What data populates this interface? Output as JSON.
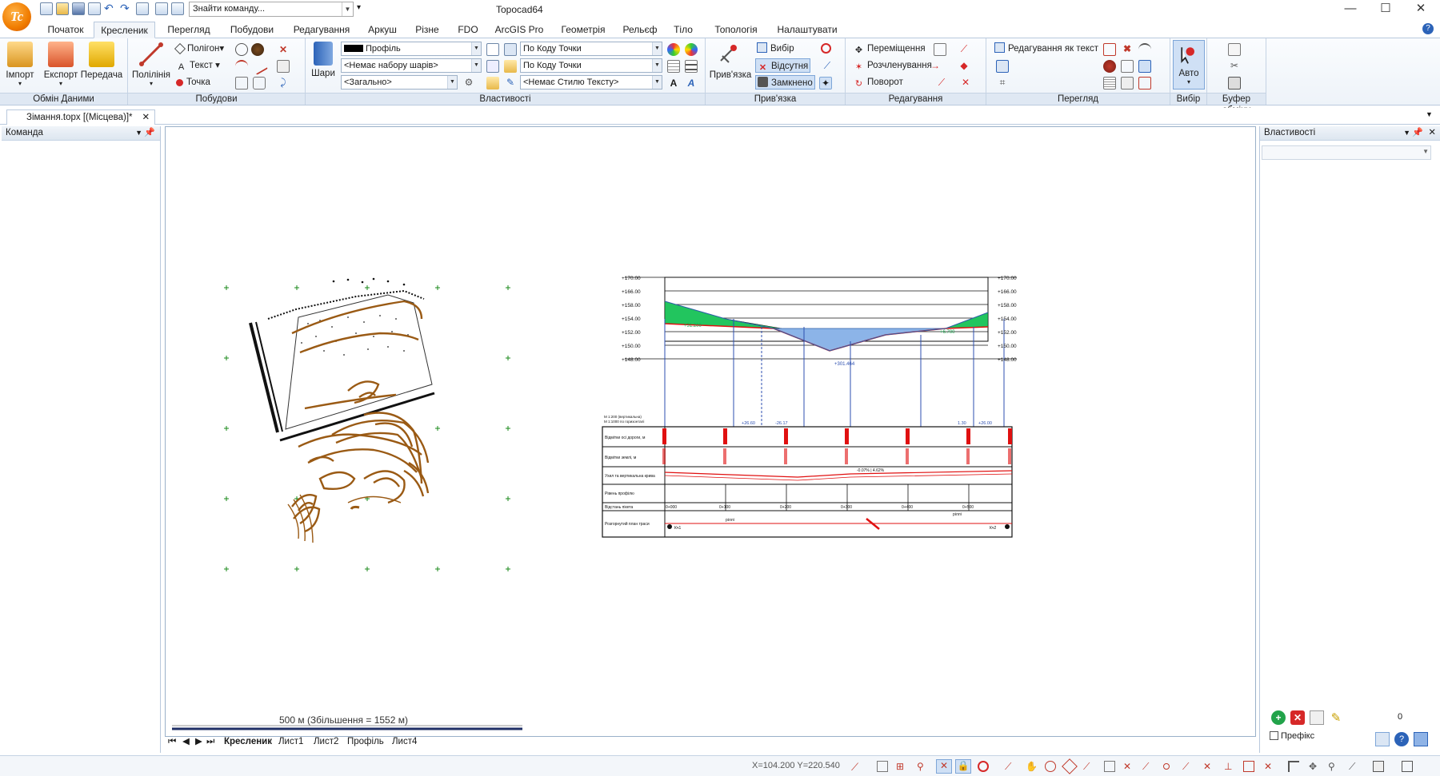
{
  "app_title": "Topocad64",
  "quick_access": {
    "search_placeholder": "Знайти команду..."
  },
  "tabs": [
    "Початок",
    "Кресленик",
    "Перегляд",
    "Побудови",
    "Редагування",
    "Аркуш",
    "Різне",
    "FDO",
    "ArcGIS Pro",
    "Геометрія",
    "Рельєф",
    "Тіло",
    "Топологія",
    "Налаштувати"
  ],
  "active_tab": "Кресленик",
  "ribbon": {
    "groups": {
      "exchange": "Обмін Даними",
      "build": "Побудови",
      "props": "Властивості",
      "snap": "Прив'язка",
      "edit": "Редагування",
      "view": "Перегляд",
      "select": "Вибір",
      "clipboard": "Буфер обміну"
    },
    "import": "Імпорт",
    "export": "Експорт",
    "transfer": "Передача",
    "polyline": "Полілінія",
    "polygon": "Полігон",
    "text": "Текст",
    "point": "Точка",
    "layers": "Шари",
    "profile_combo": "Профіль",
    "layerset_combo": "<Немає набору шарів>",
    "general_combo": "<Загально>",
    "code1_combo": "По Коду Точки",
    "code2_combo": "По Коду Точки",
    "textstyle_combo": "<Немає Стилю Тексту>",
    "snap_btn": "Прив'язка",
    "selection": "Вибір",
    "absent": "Відсутня",
    "closed": "Замкнено",
    "move": "Переміщення",
    "unbundle": "Розчленування",
    "rotate": "Поворот",
    "edit_as_text": "Редагування як текст",
    "auto": "Авто"
  },
  "document_tab": "Зімання.topx [(Місцева)]*",
  "left_panel": {
    "title": "Команда"
  },
  "right_panel": {
    "title": "Властивості",
    "counter": "0",
    "prefix_label": "Префікс"
  },
  "canvas": {
    "scale_label": "500 м (Збільшення = 1552 м)",
    "profile_y_ticks": [
      "+170.00",
      "+166.00",
      "+158.00",
      "+154.00",
      "+152.00",
      "+150.00",
      "+148.00"
    ],
    "profile_callouts": {
      "fill_left": "+31.200",
      "fill_right": "+6.700",
      "cut": "+301.464",
      "slope": "-0.07% | 4.62%"
    },
    "profile_row_labels": [
      "Відмітки осі дороги, м",
      "Відмітки землі, м",
      "Ухил та вертикальна крива",
      "Рівень профілю",
      "Відстань пікета",
      "Розгорнутий план траси"
    ],
    "profile_stations": [
      "0+000",
      "0+100",
      "0+200",
      "0+300",
      "0+400",
      "0+500"
    ],
    "profile_plan_texts": {
      "left": "ріллі",
      "mid": "ріллі",
      "right_top": "ріллі",
      "start": "Кч1",
      "end": "Кч2"
    },
    "profile_mid_labels": [
      "+26.60",
      "-26.17",
      "1.30",
      "+26.00"
    ],
    "profile_header_texts": [
      "М 1:200 (вертикальна)",
      "М 1:1000 по горизонталі"
    ]
  },
  "sheet_tabs": [
    "Кресленик",
    "Лист1",
    "Лист2",
    "Профіль",
    "Лист4"
  ],
  "active_sheet": "Кресленик",
  "status": {
    "coords": "X=104.200 Y=220.540"
  },
  "colors": {
    "accent": "#f07c00",
    "ribbon_bg": "#eef3f9",
    "group_label_bg": "#dfe8f3",
    "contour": "#9a5a14",
    "fill_green": "#22c55e",
    "cut_blue": "#8cb4e8",
    "profile_red": "#e01010"
  }
}
